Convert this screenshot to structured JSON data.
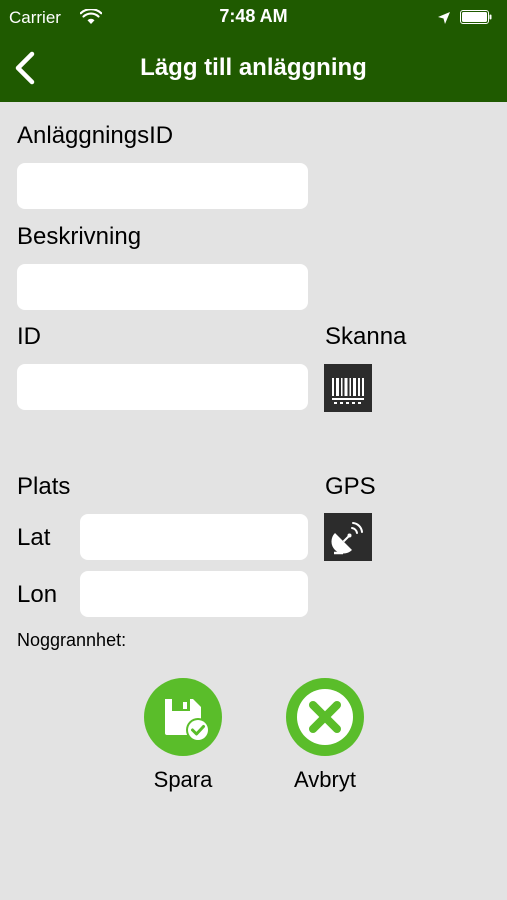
{
  "status_bar": {
    "carrier": "Carrier",
    "time": "7:48 AM"
  },
  "nav": {
    "title": "Lägg till anläggning"
  },
  "form": {
    "anlaggnings_id_label": "AnläggningsID",
    "anlaggnings_id_value": "",
    "beskrivning_label": "Beskrivning",
    "beskrivning_value": "",
    "id_label": "ID",
    "id_value": "",
    "skanna_label": "Skanna",
    "plats_label": "Plats",
    "gps_label": "GPS",
    "lat_label": "Lat",
    "lat_value": "",
    "lon_label": "Lon",
    "lon_value": "",
    "accuracy_label": "Noggrannhet:"
  },
  "actions": {
    "save_label": "Spara",
    "cancel_label": "Avbryt"
  },
  "icons": {
    "back": "chevron-left-icon",
    "barcode": "barcode-icon",
    "gps": "satellite-dish-icon",
    "save": "floppy-disk-check-icon",
    "cancel": "close-circle-icon"
  },
  "colors": {
    "header_green": "#1f5a00",
    "accent_green": "#5abd2a",
    "background": "#e3e3e3",
    "button_dark": "#2c2c2c"
  }
}
